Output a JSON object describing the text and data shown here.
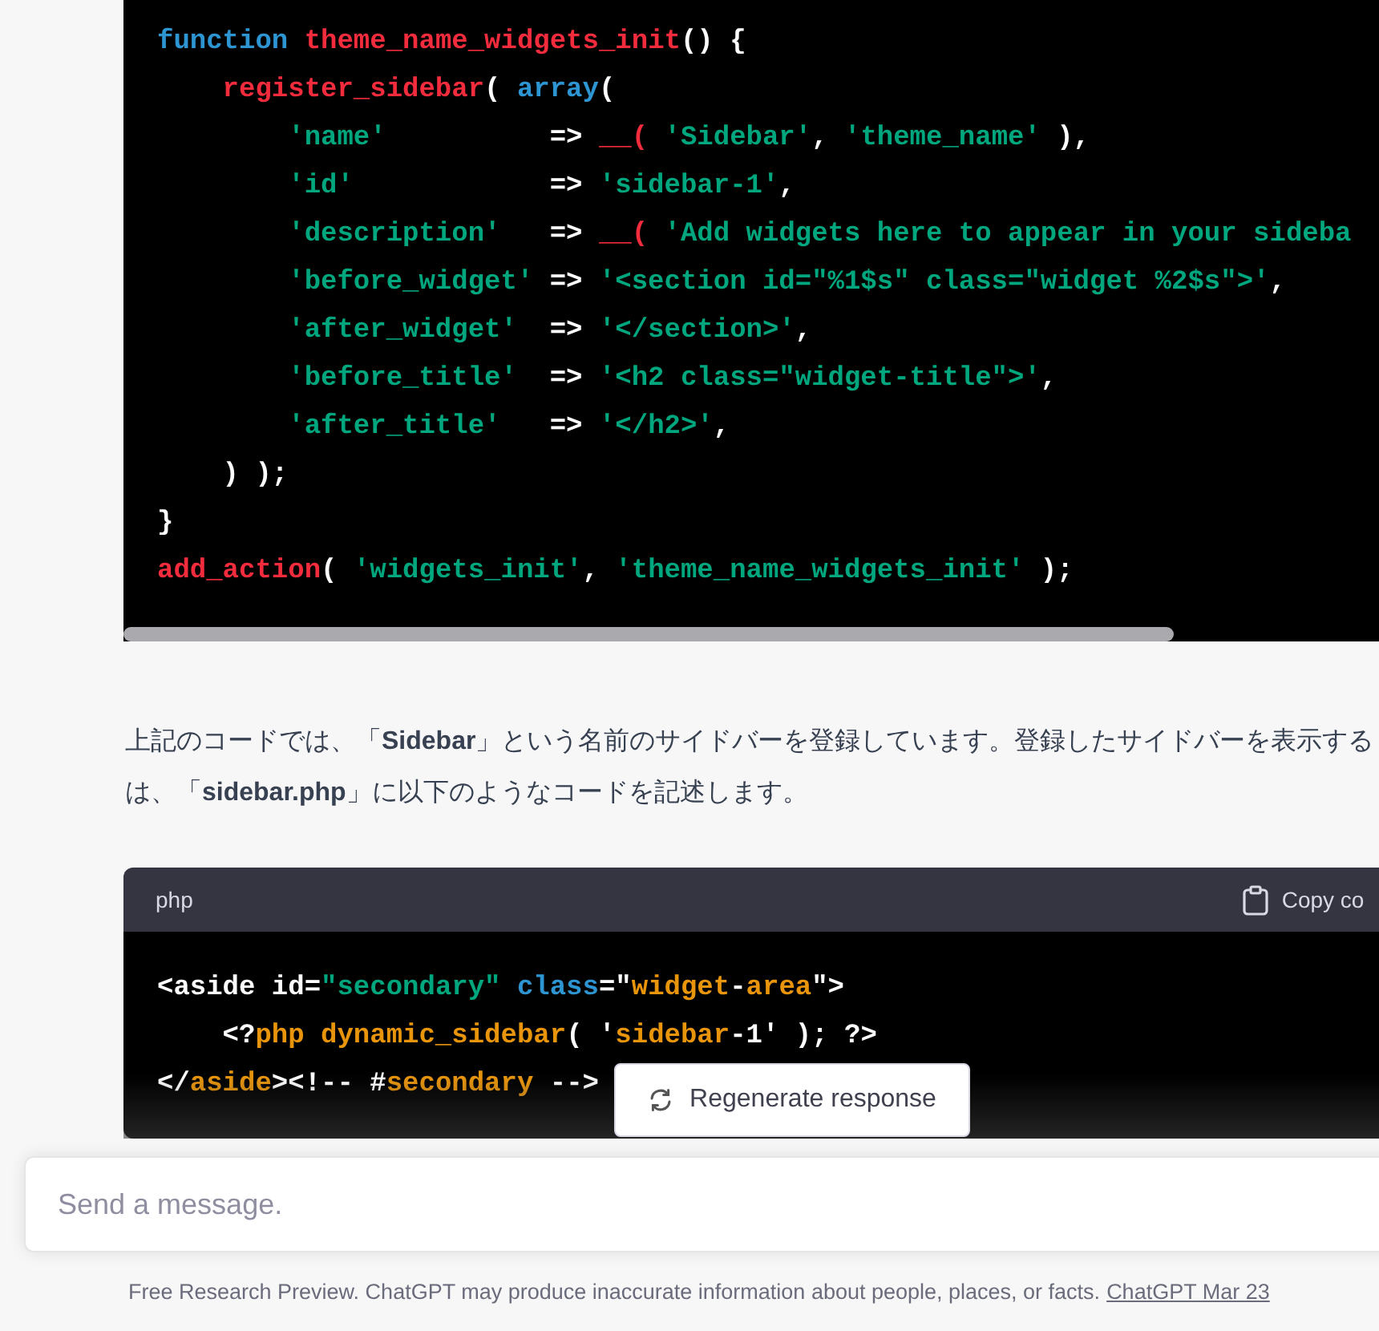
{
  "code_blocks": [
    {
      "lines": [
        [
          {
            "kind": "keyword",
            "t": "function "
          },
          {
            "kind": "function",
            "t": "theme_name_widgets_init"
          },
          {
            "kind": "plain",
            "t": "() {"
          }
        ],
        [
          {
            "kind": "function",
            "t": "    register_sidebar"
          },
          {
            "kind": "plain",
            "t": "( "
          },
          {
            "kind": "keyword",
            "t": "array"
          },
          {
            "kind": "plain",
            "t": "("
          }
        ],
        [
          {
            "kind": "string",
            "t": "        'name'"
          },
          {
            "kind": "plain",
            "t": "          => "
          },
          {
            "kind": "function",
            "t": "__( "
          },
          {
            "kind": "string",
            "t": "'Sidebar'"
          },
          {
            "kind": "plain",
            "t": ", "
          },
          {
            "kind": "string",
            "t": "'theme_name'"
          },
          {
            "kind": "plain",
            "t": " ),"
          }
        ],
        [
          {
            "kind": "string",
            "t": "        'id'"
          },
          {
            "kind": "plain",
            "t": "            => "
          },
          {
            "kind": "string",
            "t": "'sidebar-1'"
          },
          {
            "kind": "plain",
            "t": ","
          }
        ],
        [
          {
            "kind": "string",
            "t": "        'description'"
          },
          {
            "kind": "plain",
            "t": "   => "
          },
          {
            "kind": "function",
            "t": "__( "
          },
          {
            "kind": "string",
            "t": "'Add widgets here to appear in your sideba"
          }
        ],
        [
          {
            "kind": "string",
            "t": "        'before_widget'"
          },
          {
            "kind": "plain",
            "t": " => "
          },
          {
            "kind": "string",
            "t": "'<section id=\"%1$s\" class=\"widget %2$s\">'"
          },
          {
            "kind": "plain",
            "t": ","
          }
        ],
        [
          {
            "kind": "string",
            "t": "        'after_widget'"
          },
          {
            "kind": "plain",
            "t": "  => "
          },
          {
            "kind": "string",
            "t": "'</section>'"
          },
          {
            "kind": "plain",
            "t": ","
          }
        ],
        [
          {
            "kind": "string",
            "t": "        'before_title'"
          },
          {
            "kind": "plain",
            "t": "  => "
          },
          {
            "kind": "string",
            "t": "'<h2 class=\"widget-title\">'"
          },
          {
            "kind": "plain",
            "t": ","
          }
        ],
        [
          {
            "kind": "string",
            "t": "        'after_title'"
          },
          {
            "kind": "plain",
            "t": "   => "
          },
          {
            "kind": "string",
            "t": "'</h2>'"
          },
          {
            "kind": "plain",
            "t": ","
          }
        ],
        [
          {
            "kind": "plain",
            "t": "    ) );"
          }
        ],
        [
          {
            "kind": "plain",
            "t": "}"
          }
        ],
        [
          {
            "kind": "function",
            "t": "add_action"
          },
          {
            "kind": "plain",
            "t": "( "
          },
          {
            "kind": "string",
            "t": "'widgets_init'"
          },
          {
            "kind": "plain",
            "t": ", "
          },
          {
            "kind": "string",
            "t": "'theme_name_widgets_init'"
          },
          {
            "kind": "plain",
            "t": " );"
          }
        ]
      ]
    }
  ],
  "paragraph": [
    "上記のコードでは、「**Sidebar**」という名前のサイドバーを登録しています。登録したサイドバーを表示する",
    "は、「**sidebar.php**」に以下のようなコードを記述します。"
  ],
  "code_block_2": {
    "language": "php",
    "copy_label": "Copy co",
    "lines": [
      [
        {
          "kind": "plain",
          "t": "<aside id="
        },
        {
          "kind": "string",
          "t": "\"secondary\""
        },
        {
          "kind": "keyword",
          "t": " class"
        },
        {
          "kind": "plain",
          "t": "=\""
        },
        {
          "kind": "tag",
          "t": "widget"
        },
        {
          "kind": "plain",
          "t": "-"
        },
        {
          "kind": "tag",
          "t": "area"
        },
        {
          "kind": "plain",
          "t": "\">"
        }
      ],
      [
        {
          "kind": "plain",
          "t": "    <?"
        },
        {
          "kind": "tag",
          "t": "php dynamic_sidebar"
        },
        {
          "kind": "plain",
          "t": "( '"
        },
        {
          "kind": "tag",
          "t": "sidebar"
        },
        {
          "kind": "plain",
          "t": "-1' ); ?>"
        }
      ],
      [
        {
          "kind": "plain",
          "t": "</"
        },
        {
          "kind": "tag",
          "t": "aside"
        },
        {
          "kind": "plain",
          "t": "><!-- #"
        },
        {
          "kind": "tag",
          "t": "secondary"
        },
        {
          "kind": "plain",
          "t": " -->"
        }
      ]
    ]
  },
  "regenerate_button": "Regenerate response",
  "message_input": {
    "placeholder": "Send a message."
  },
  "footer": {
    "text": "Free Research Preview. ChatGPT may produce inaccurate information about people, places, or facts.",
    "link": "ChatGPT Mar 23"
  }
}
